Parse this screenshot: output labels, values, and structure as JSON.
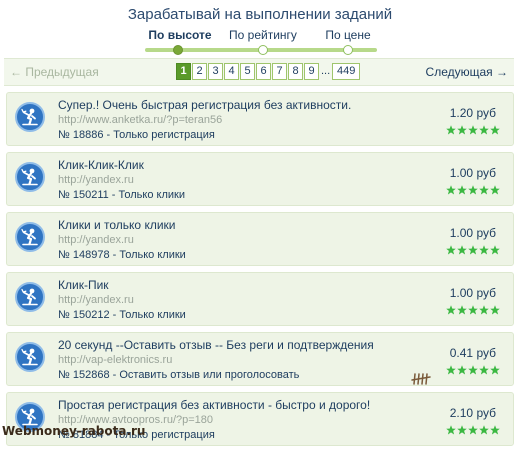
{
  "header": {
    "title": "Зарабатывай на выполнении заданий"
  },
  "sort_tabs": [
    {
      "label": "По высоте",
      "active": true
    },
    {
      "label": "По рейтингу",
      "active": false
    },
    {
      "label": "По цене",
      "active": false
    }
  ],
  "pagination": {
    "prev_label": "← Предыдущая",
    "next_label": "Следующая →",
    "pages": [
      "1",
      "2",
      "3",
      "4",
      "5",
      "6",
      "7",
      "8",
      "9"
    ],
    "ellipsis": "...",
    "last_page": "449",
    "current_page": "1"
  },
  "tasks": [
    {
      "title": "Супер.! Очень быстрая регистрация без активности.",
      "url": "http://www.anketka.ru/?p=teran56",
      "id_text": "№ 18886",
      "separator": " - ",
      "type": "Только регистрация",
      "price": "1.20 руб",
      "rating_stars": 5
    },
    {
      "title": "Клик-Клик-Клик",
      "url": "http://yandex.ru",
      "id_text": "№ 150211",
      "separator": " - ",
      "type": "Только клики",
      "price": "1.00 руб",
      "rating_stars": 5
    },
    {
      "title": "Клики и только клики",
      "url": "http://yandex.ru",
      "id_text": "№ 148978",
      "separator": " - ",
      "type": "Только клики",
      "price": "1.00 руб",
      "rating_stars": 5
    },
    {
      "title": "Клик-Пик",
      "url": "http://yandex.ru",
      "id_text": "№ 150212",
      "separator": " - ",
      "type": "Только клики",
      "price": "1.00 руб",
      "rating_stars": 5
    },
    {
      "title": "20 секунд --Оставить отзыв -- Без реги и подтверждения",
      "url": "http://vap-elektronics.ru",
      "id_text": "№ 152868",
      "separator": " - ",
      "type": "Оставить отзыв или проголосовать",
      "price": "0.41 руб",
      "rating_stars": 5
    },
    {
      "title": "Простая регистрация без активности - быстро и дорого!",
      "url": "http://www.avtoopros.ru/?p=180",
      "id_text": "№ 81884",
      "separator": " - ",
      "type": "Только регистрация",
      "price": "2.10 руб",
      "rating_stars": 5
    }
  ],
  "watermark": "Webmoney-rabota.ru",
  "colors": {
    "accent_green": "#5a9a2a",
    "star_green": "#3cb843",
    "icon_blue": "#2f74c2",
    "row_bg": "#eef4e6"
  },
  "icons": {
    "task": "worker-icon",
    "rating": "star-icon",
    "tally": "tally-marks-icon"
  }
}
